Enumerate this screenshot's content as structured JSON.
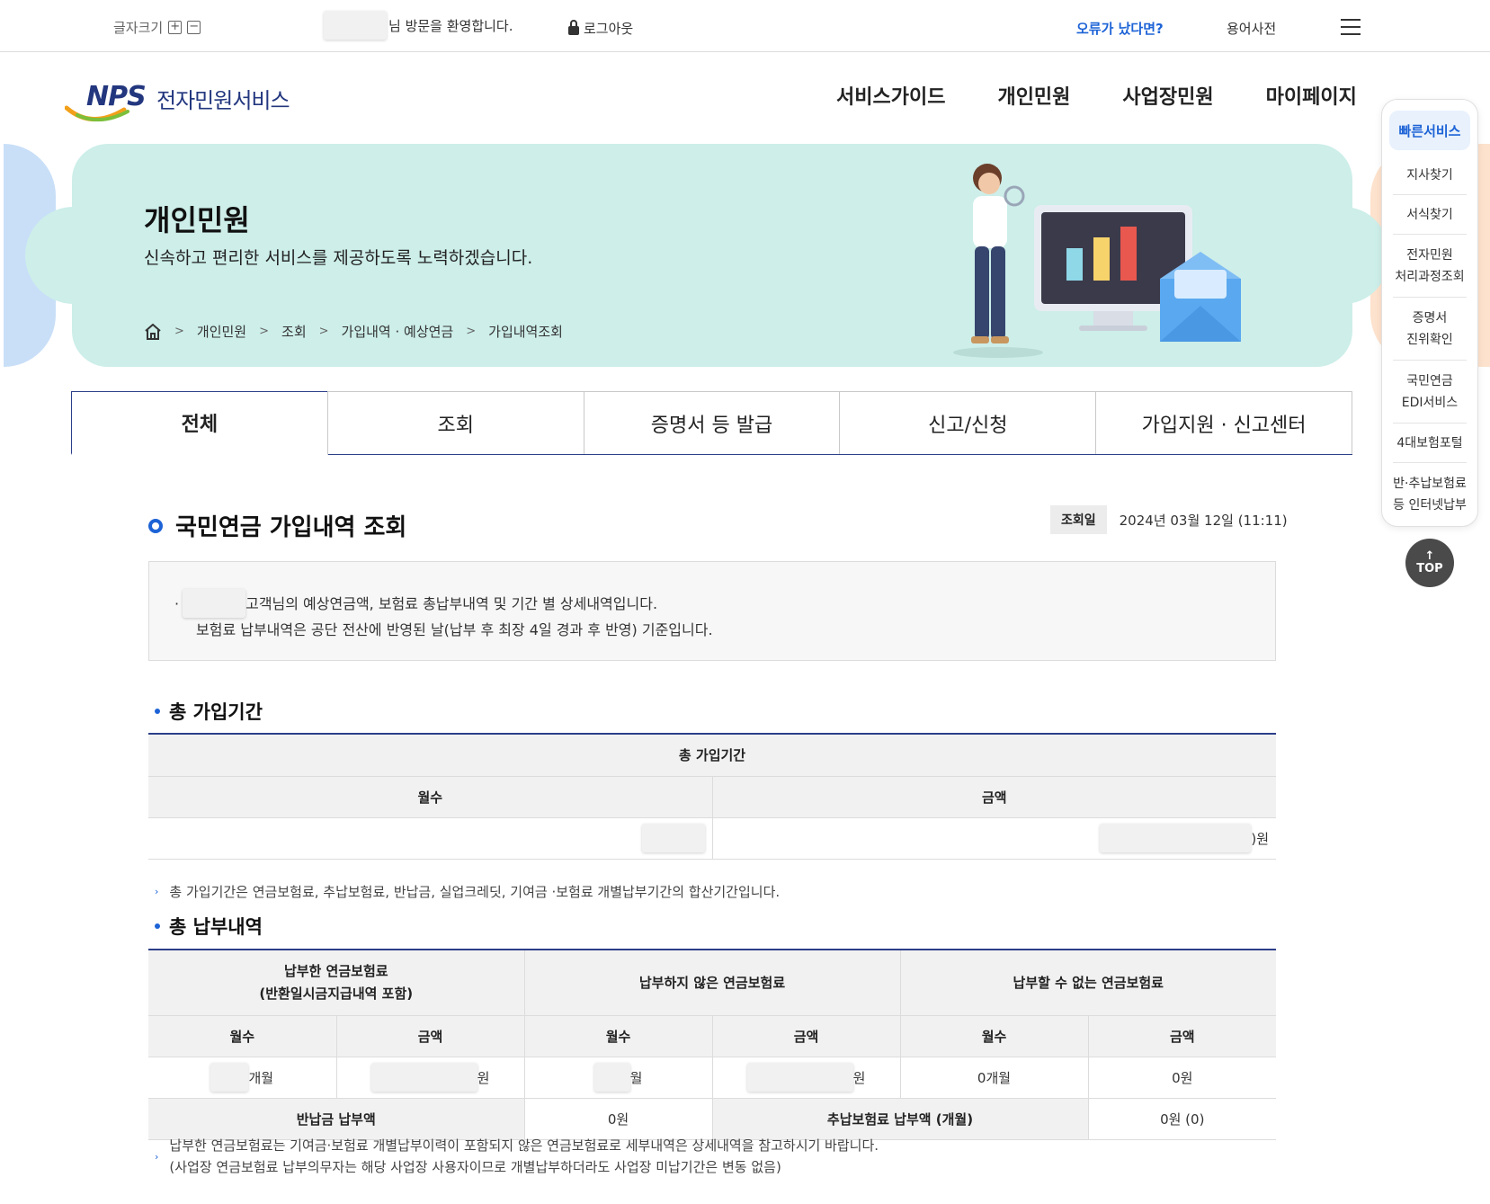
{
  "utility": {
    "font_size_label": "글자크기",
    "welcome_text": "님 방문을 환영합니다.",
    "logout_label": "로그아웃",
    "error_report": "오류가 났다면?",
    "dictionary": "용어사전"
  },
  "header": {
    "logo_mark": "NPS",
    "logo_text": "전자민원서비스",
    "nav": [
      "서비스가이드",
      "개인민원",
      "사업장민원",
      "마이페이지"
    ]
  },
  "banner": {
    "title": "개인민원",
    "subtitle": "신속하고 편리한 서비스를 제공하도록 노력하겠습니다.",
    "breadcrumb": [
      "개인민원",
      "조회",
      "가입내역 · 예상연금",
      "가입내역조회"
    ]
  },
  "tabs": [
    "전체",
    "조회",
    "증명서 등 발급",
    "신고/신청",
    "가입지원 · 신고센터"
  ],
  "page": {
    "title": "국민연금 가입내역 조회",
    "query_label": "조회일",
    "query_date": "2024년 03월 12일 (11:11)",
    "notice_line1": "고객님의 예상연금액, 보험료 총납부내역 및 기간 별 상세내역입니다.",
    "notice_line2": "보험료 납부내역은 공단 전산에 반영된 날(납부 후 최장 4일 경과 후 반영) 기준입니다."
  },
  "total_period": {
    "heading": "총 가입기간",
    "table_title": "총 가입기간",
    "col_months": "월수",
    "col_amount": "금액",
    "amount_suffix": ")원",
    "note": "총 가입기간은 연금보험료, 추납보험료, 반납금, 실업크레딧, 기여금 ·보험료 개별납부기간의 합산기간입니다."
  },
  "total_payment": {
    "heading": "총 납부내역",
    "group_paid_l1": "납부한 연금보험료",
    "group_paid_l2": "(반환일시금지급내역 포함)",
    "group_unpaid": "납부하지 않은 연금보험료",
    "group_cannot": "납부할 수 없는 연금보험료",
    "col_months": "월수",
    "col_amount": "금액",
    "paid_months_suffix": "개월",
    "paid_amount_suffix": "원",
    "unpaid_months_suffix": "월",
    "unpaid_amount_suffix": "원",
    "cannot_months": "0개월",
    "cannot_amount": "0원",
    "refund_label": "반납금 납부액",
    "refund_value": "0원",
    "additional_label": "추납보험료 납부액 (개월)",
    "additional_value": "0원 (0)",
    "note_l1": "납부한 연금보험료는 기여금·보험료 개별납부이력이 포함되지 않은 연금보험료로 세부내역은 상세내역을 참고하시기 바랍니다.",
    "note_l2": "(사업장 연금보험료 납부의무자는 해당 사업장 사용자이므로 개별납부하더라도 사업장 미납기간은 변동 없음)"
  },
  "quick_menu": {
    "title": "빠른서비스",
    "items": [
      [
        "지사찾기"
      ],
      [
        "서식찾기"
      ],
      [
        "전자민원",
        "처리과정조회"
      ],
      [
        "증명서",
        "진위확인"
      ],
      [
        "국민연금",
        "EDI서비스"
      ],
      [
        "4대보험포털"
      ],
      [
        "반·추납보험료",
        "등 인터넷납부"
      ]
    ],
    "top_label": "TOP"
  },
  "colors": {
    "accent": "#1d63d6",
    "navy": "#2c3f8a",
    "banner": "#cdeee9"
  }
}
